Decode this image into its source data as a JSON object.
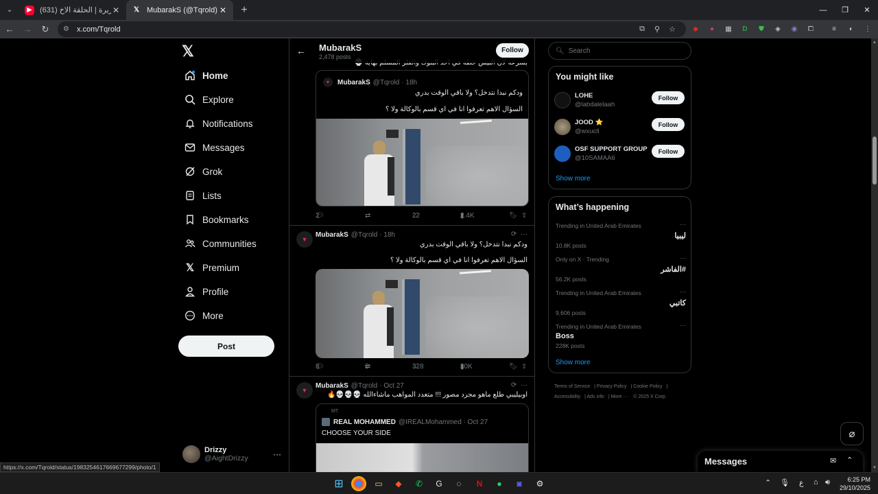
{
  "browser": {
    "tabs": [
      {
        "title": "(631) نهاية الجزيرة | الحلقة الاخ...",
        "favicon": "youtube-icon",
        "active": false
      },
      {
        "title": "MubarakS (@Tqrold) / X",
        "favicon": "x-icon",
        "active": true
      }
    ],
    "url": "x.com/Tqrold",
    "status_url": "https://x.com/Tqrold/status/1983254617669677299/photo/1"
  },
  "nav": {
    "items": [
      {
        "label": "Home",
        "icon": "home-icon"
      },
      {
        "label": "Explore",
        "icon": "search-icon"
      },
      {
        "label": "Notifications",
        "icon": "bell-icon"
      },
      {
        "label": "Messages",
        "icon": "envelope-icon"
      },
      {
        "label": "Grok",
        "icon": "grok-icon"
      },
      {
        "label": "Lists",
        "icon": "list-icon"
      },
      {
        "label": "Bookmarks",
        "icon": "bookmark-icon"
      },
      {
        "label": "Communities",
        "icon": "people-icon"
      },
      {
        "label": "Premium",
        "icon": "x-icon"
      },
      {
        "label": "Profile",
        "icon": "person-icon"
      },
      {
        "label": "More",
        "icon": "more-circle-icon"
      }
    ],
    "post_label": "Post",
    "account": {
      "name": "Drizzy",
      "handle": "@AightDrizzy"
    }
  },
  "profile_header": {
    "name": "MubarakS",
    "posts_count": "2,478 posts",
    "follow_label": "Follow"
  },
  "feed": {
    "cut_text": "بسرعة لان النيس حطة في احد البنوك والفلز المسلم بهاية 💀",
    "quote1": {
      "name": "MubarakS",
      "handle": "@Tqrold",
      "time": "· 18h",
      "line1": "ودكم نبدا نتدخل؟ ولا باقي الوقت بدري",
      "line2": "السؤال الاهم تعرفوا انا في اي قسم بالوكالة ولا ؟"
    },
    "actions1": {
      "replies": "2",
      "reposts": "",
      "likes": "22",
      "views": "2.4K"
    },
    "tweet2": {
      "name": "MubarakS",
      "handle": "@Tqrold",
      "time": "· 18h",
      "line1": "ودكم نبدا نتدخل؟ ولا باقي الوقت بدري",
      "line2": "السؤال الاهم تعرفوا انا في اي قسم بالوكالة ولا ؟"
    },
    "actions2": {
      "replies": "8",
      "reposts": "6",
      "likes": "328",
      "views": "30K"
    },
    "tweet3": {
      "name": "MubarakS",
      "handle": "@Tqrold",
      "time": "· Oct 27",
      "text": "اوبيليبي طلع ماهو مجرد مصور !!! متعدد المواهب ماشاءالله 💀💀💀🔥",
      "quote_meta": "MT",
      "quote_name": "REAL MOHAMMED",
      "quote_handle": "@IREALMohammed · Oct 27",
      "quote_text": "CHOOSE YOUR SIDE"
    }
  },
  "sidebar": {
    "search_placeholder": "Search",
    "might_like": {
      "title": "You might like",
      "users": [
        {
          "name": "LOHE",
          "handle": "@labdalelaah",
          "follow": "Follow"
        },
        {
          "name": "JOOD ⭐",
          "handle": "@wxucll",
          "follow": "Follow"
        },
        {
          "name": "OSF SUPPORT GROUP",
          "handle": "@10SAMAA6",
          "follow": "Follow"
        }
      ],
      "show_more": "Show more"
    },
    "happening": {
      "title": "What’s happening",
      "trends": [
        {
          "context": "Trending in United Arab Emirates",
          "name": "ليبيا",
          "count": "10.8K posts",
          "rtl": true
        },
        {
          "context": "Only on X · Trending",
          "name": "#الفاشر",
          "count": "56.2K posts",
          "rtl": true
        },
        {
          "context": "Trending in United Arab Emirates",
          "name": "كاتبي",
          "count": "9,606 posts",
          "rtl": true
        },
        {
          "context": "Trending in United Arab Emirates",
          "name": "Boss",
          "count": "228K posts",
          "rtl": false
        }
      ],
      "show_more": "Show more"
    },
    "footer": [
      "Terms of Service",
      "Privacy Policy",
      "Cookie Policy",
      "Accessibility",
      "Ads info",
      "More ···",
      "© 2025 X Corp."
    ]
  },
  "messages_drawer": {
    "title": "Messages"
  },
  "taskbar": {
    "time": "6:25 PM",
    "date": "29/10/2025",
    "lang": "ع"
  },
  "colors": {
    "accent": "#1d9bf0",
    "background": "#000000",
    "border": "#2f3336",
    "muted": "#71767b"
  }
}
